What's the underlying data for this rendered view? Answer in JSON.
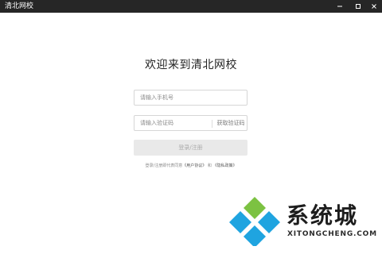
{
  "window": {
    "title": "清北网校",
    "controls": [
      "minimize-icon",
      "maximize-icon",
      "close-icon"
    ]
  },
  "main": {
    "welcome": "欢迎来到清北网校",
    "phone_placeholder": "请输入手机号",
    "code_placeholder": "请输入验证码",
    "get_code_label": "获取验证码",
    "login_label": "登录/注册",
    "agreement": {
      "prefix": "登录/注册即代表同意",
      "user_agreement": "《用户协议》",
      "conjunction": "和",
      "privacy_policy": "《隐私政策》"
    }
  },
  "watermark": {
    "text": "系统城",
    "url": "XITONGCHENG.COM"
  },
  "colors": {
    "titlebar": "#262626",
    "login_button": "#e9e9e9",
    "logo_green": "#7cc242",
    "logo_blue": "#1fa4e0"
  }
}
